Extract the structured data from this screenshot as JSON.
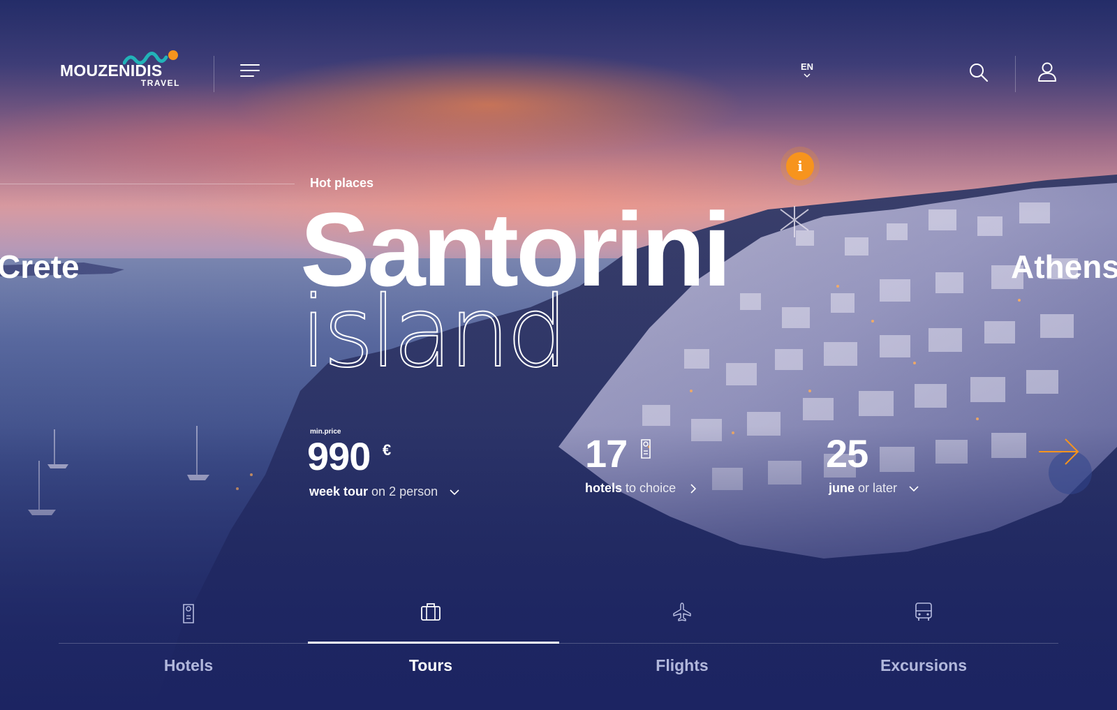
{
  "header": {
    "brand": "MOUZENIDIS",
    "brand_sub": "TRAVEL",
    "language": "EN"
  },
  "hero": {
    "tag": "Hot places",
    "title": "Santorini",
    "subtitle": "island",
    "prev_city": "Crete",
    "next_city": "Athens",
    "info_icon_glyph": "i"
  },
  "stats": {
    "price": {
      "label": "min.price",
      "value": "990",
      "currency": "€",
      "caption_bold": "week tour",
      "caption_light": "on 2 person"
    },
    "hotels": {
      "value": "17",
      "caption_bold": "hotels",
      "caption_light": "to choice"
    },
    "date": {
      "value": "25",
      "caption_bold": "june",
      "caption_light": "or later"
    }
  },
  "tabs": [
    {
      "label": "Hotels",
      "icon": "hotel-tag-icon"
    },
    {
      "label": "Tours",
      "icon": "suitcase-icon",
      "active": true
    },
    {
      "label": "Flights",
      "icon": "airplane-icon"
    },
    {
      "label": "Excursions",
      "icon": "bus-icon"
    }
  ],
  "colors": {
    "accent": "#f7941d",
    "brand_wave": "#22b3b8",
    "overlay": "#1f2a63"
  }
}
